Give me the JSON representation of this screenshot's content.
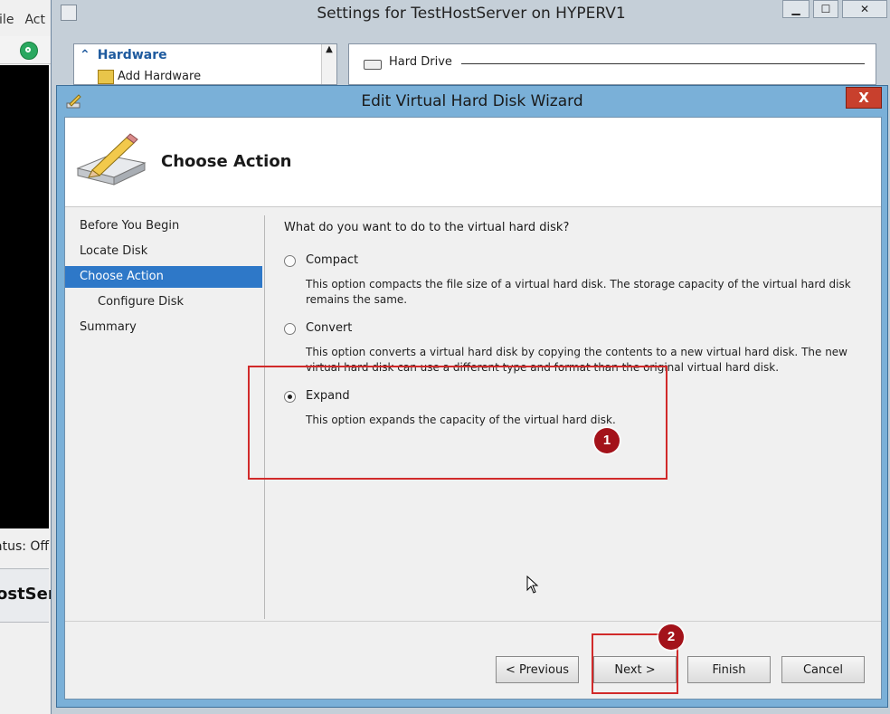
{
  "background_app": {
    "menu": [
      "File",
      "Act"
    ],
    "status_text": "atus: Off",
    "host_name": "ostSer"
  },
  "settings_window": {
    "title": "Settings for TestHostServer on HYPERV1",
    "hardware_header": "Hardware",
    "add_hardware": "Add Hardware",
    "hard_drive_label": "Hard Drive"
  },
  "wizard": {
    "title": "Edit Virtual Hard Disk Wizard",
    "close_label": "X",
    "page_title": "Choose Action",
    "steps": [
      {
        "label": "Before You Begin"
      },
      {
        "label": "Locate Disk"
      },
      {
        "label": "Choose Action"
      },
      {
        "label": "Configure Disk"
      },
      {
        "label": "Summary"
      }
    ],
    "question": "What do you want to do to the virtual hard disk?",
    "options": [
      {
        "label": "Compact",
        "description": "This option compacts the file size of a virtual hard disk. The storage capacity of the virtual hard disk remains the same.",
        "selected": false
      },
      {
        "label": "Convert",
        "description": "This option converts a virtual hard disk by copying the contents to a new virtual hard disk. The new virtual hard disk can use a different type and format than the original virtual hard disk.",
        "selected": false
      },
      {
        "label": "Expand",
        "description": "This option expands the capacity of the virtual hard disk.",
        "selected": true
      }
    ],
    "buttons": {
      "previous": "< Previous",
      "next": "Next >",
      "finish": "Finish",
      "cancel": "Cancel"
    }
  },
  "annotations": {
    "badge1": "1",
    "badge2": "2",
    "highlight_color": "#d12a2a",
    "badge_color": "#a3121a"
  },
  "colors": {
    "selected_step": "#2e78c8",
    "window_frame": "#7ab0d8",
    "close_button": "#c8402d"
  }
}
